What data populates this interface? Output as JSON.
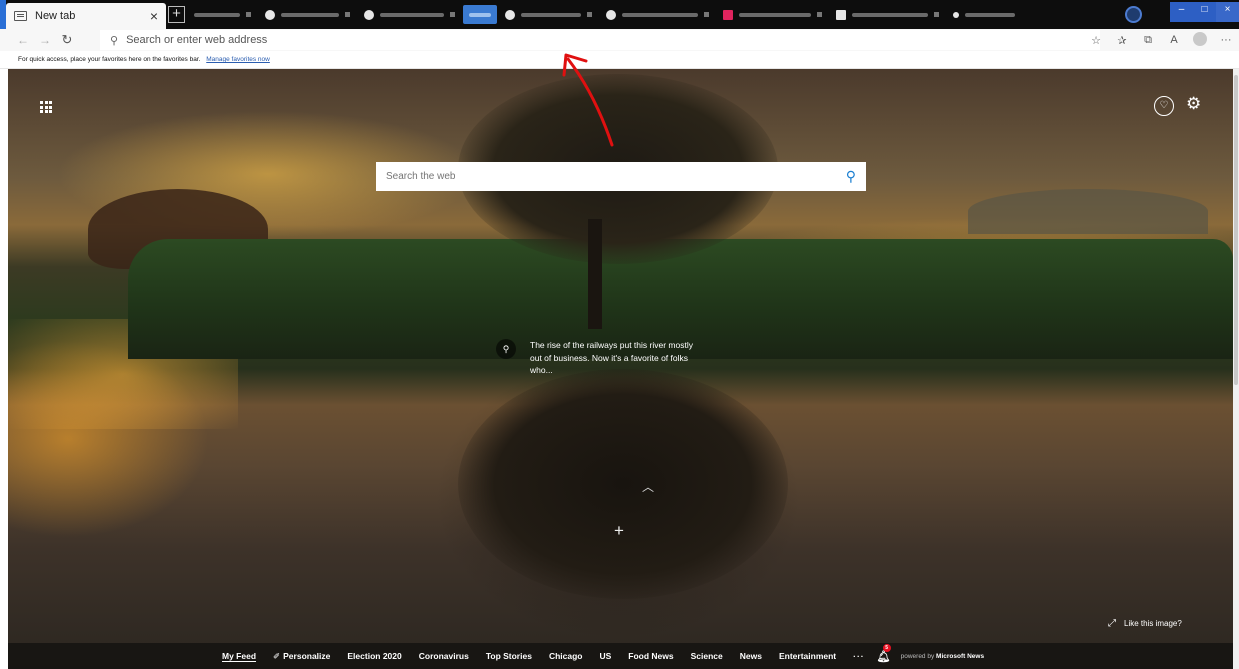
{
  "browser": {
    "active_tab": {
      "title": "New tab",
      "close_glyph": "×"
    },
    "new_tab_glyph": "+",
    "window_controls": {
      "minimize": "–",
      "maximize": "□",
      "close": "×"
    }
  },
  "toolbar": {
    "back_glyph": "←",
    "forward_glyph": "→",
    "refresh_glyph": "↻",
    "address_placeholder": "Search or enter web address",
    "icons": [
      "star-icon",
      "favorites-icon",
      "collections-icon",
      "read-aloud-icon",
      "profile-icon",
      "more-icon"
    ],
    "star_glyph": "☆",
    "favorites_glyph": "✰",
    "collections_glyph": "⧉",
    "read_glyph": "A",
    "more_glyph": "···"
  },
  "favorites_bar": {
    "message": "For quick access, place your favorites here on the favorites bar.",
    "link": "Manage favorites now"
  },
  "newtab": {
    "search_placeholder": "Search the web",
    "caption": "The rise of the railways put this river mostly out of business. Now it's a favorite of folks who...",
    "like_image": "Like this image?",
    "news_nav": {
      "items": [
        "My Feed",
        "Personalize",
        "Election 2020",
        "Coronavirus",
        "Top Stories",
        "Chicago",
        "US",
        "Food News",
        "Science",
        "News",
        "Entertainment"
      ],
      "more": "···",
      "notification_count": "5",
      "powered_by_prefix": "powered by",
      "powered_by_brand": "Microsoft News"
    }
  },
  "colors": {
    "annotation_arrow": "#e01010",
    "search_icon": "#1b7fd1",
    "link": "#2a5db0"
  }
}
